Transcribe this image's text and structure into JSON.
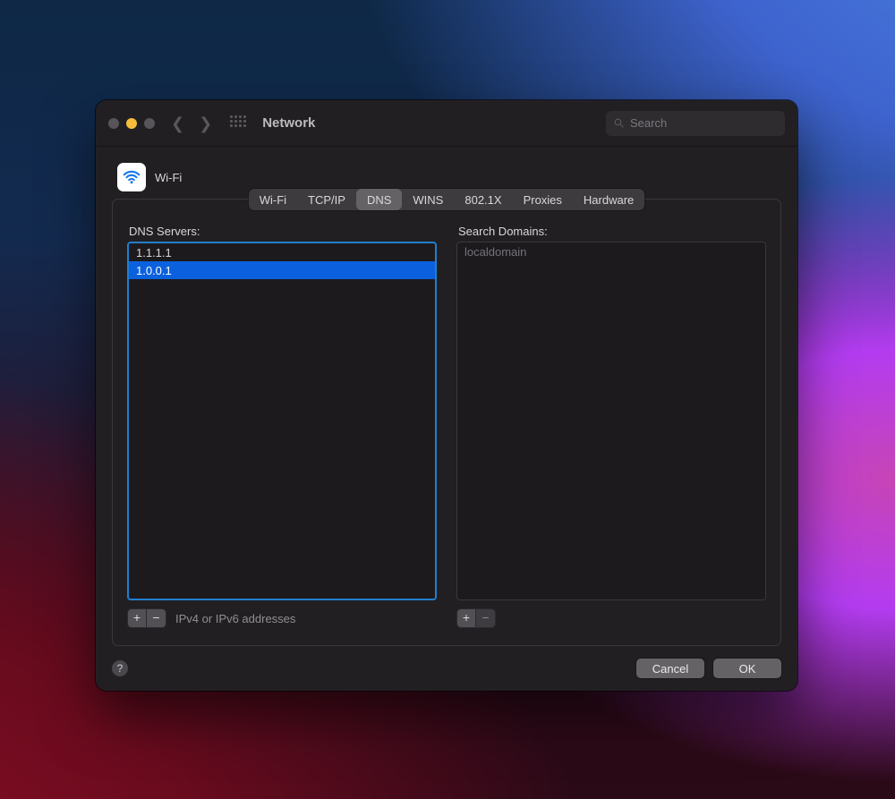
{
  "window": {
    "title": "Network",
    "search_placeholder": "Search"
  },
  "header": {
    "interface": "Wi-Fi"
  },
  "tabs": {
    "items": [
      "Wi-Fi",
      "TCP/IP",
      "DNS",
      "WINS",
      "802.1X",
      "Proxies",
      "Hardware"
    ],
    "active": "DNS"
  },
  "dns": {
    "label": "DNS Servers:",
    "servers": [
      "1.1.1.1",
      "1.0.0.1"
    ],
    "selected_index": 1,
    "hint": "IPv4 or IPv6 addresses"
  },
  "domains": {
    "label": "Search Domains:",
    "items": [
      "localdomain"
    ],
    "remove_enabled": false
  },
  "footer": {
    "cancel": "Cancel",
    "ok": "OK"
  }
}
